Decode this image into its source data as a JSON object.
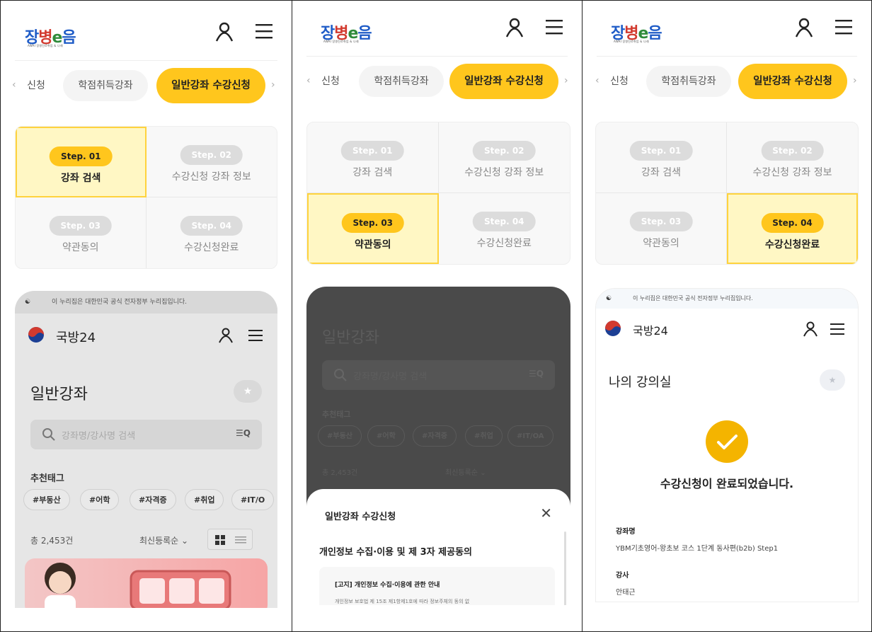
{
  "header": {
    "logo_parts": [
      "장",
      "병",
      "e",
      "음"
    ],
    "logo_sub": "AWAI 장병진로취업 & 나래"
  },
  "tabs": {
    "prev": "신청",
    "middle": "학점취득강좌",
    "active": "일반강좌 수강신청"
  },
  "steps": [
    {
      "badge": "Step. 01",
      "label": "강좌 검색"
    },
    {
      "badge": "Step. 02",
      "label": "수강신청 강좌 정보"
    },
    {
      "badge": "Step. 03",
      "label": "약관동의"
    },
    {
      "badge": "Step. 04",
      "label": "수강신청완료"
    }
  ],
  "gov": {
    "notice": "이 누리집은 대한민국 공식 전자정부 누리집입니다.",
    "brand": "국방24"
  },
  "course_page": {
    "title": "일반강좌",
    "search_placeholder": "강좌명/강사명 검색",
    "tags_title": "추천태그",
    "tags": [
      "#부동산",
      "#어학",
      "#자격증",
      "#취업",
      "#IT/O"
    ],
    "tags_p2": [
      "#부동산",
      "#어학",
      "#자격증",
      "#취업",
      "#IT/OA"
    ],
    "count": "총 2,453건",
    "sort": "최신등록순"
  },
  "sheet": {
    "title": "일반강좌 수강신청",
    "subtitle": "개인정보 수집·이용 및 제 3자 제공동의",
    "box_title": "[고지] 개인정보 수집·이용에 관한 안내",
    "box_text": "개인정보 보호법 제 15조 제1항제1호에 따라 정보주체의 동의 없"
  },
  "done_page": {
    "title": "나의 강의실",
    "message": "수강신청이 완료되었습니다.",
    "course_label": "강좌명",
    "course_value": "YBM기초영어-왕초보 코스 1단계 동사편(b2b) Step1",
    "teacher_label": "강사",
    "teacher_value": "안태근"
  },
  "colors": {
    "accent": "#ffc61d",
    "step_active_bg": "#fff7c4",
    "check": "#f4b400"
  }
}
